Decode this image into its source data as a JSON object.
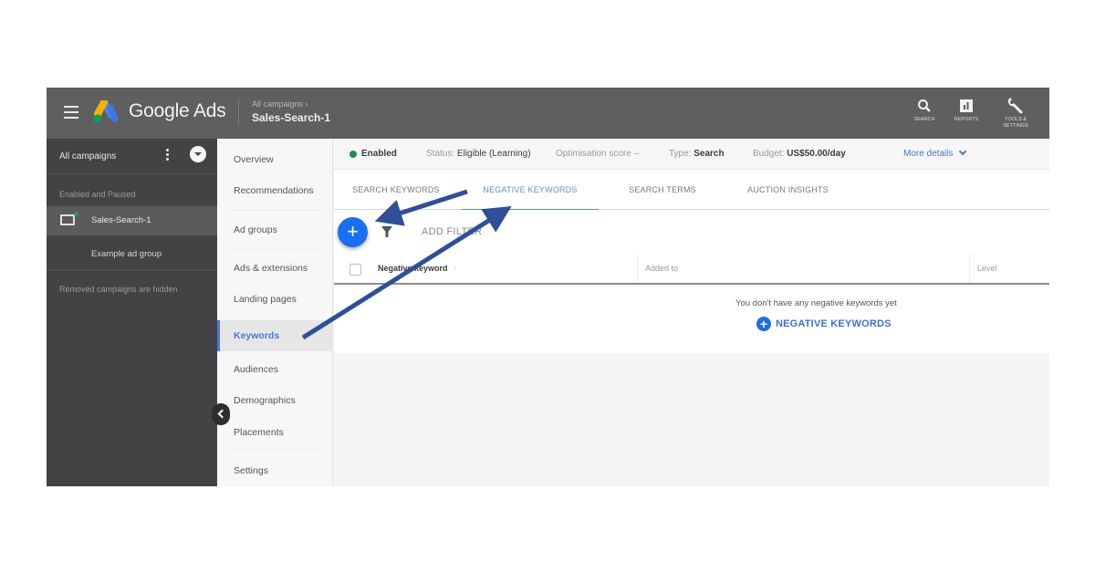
{
  "app": {
    "brand": "Google Ads",
    "breadcrumb_parent": "All campaigns",
    "breadcrumb_current": "Sales-Search-1"
  },
  "toolbar_right": [
    {
      "icon": "search-icon",
      "label": "SEARCH"
    },
    {
      "icon": "reports-icon",
      "label": "REPORTS"
    },
    {
      "icon": "wrench-icon",
      "label": "TOOLS & SETTINGS"
    }
  ],
  "left_panel": {
    "title": "All campaigns",
    "section_label": "Enabled and Paused",
    "campaign": "Sales-Search-1",
    "campaign_status_color": "#1e9e5a",
    "ad_group": "Example ad group",
    "removed_note": "Removed campaigns are hidden"
  },
  "nav": {
    "items": [
      {
        "label": "Overview",
        "active": false
      },
      {
        "label": "Recommendations",
        "active": false
      },
      {
        "label": "Ad groups",
        "active": false
      },
      {
        "label": "Ads & extensions",
        "active": false
      },
      {
        "label": "Landing pages",
        "active": false
      },
      {
        "label": "Keywords",
        "active": true
      },
      {
        "label": "Audiences",
        "active": false
      },
      {
        "label": "Demographics",
        "active": false
      },
      {
        "label": "Placements",
        "active": false
      },
      {
        "label": "Settings",
        "active": false
      }
    ]
  },
  "status_bar": {
    "enabled": "Enabled",
    "status_label": "Status:",
    "status_value": "Eligible (Learning)",
    "opt_label": "Optimisation score",
    "opt_value": "–",
    "type_label": "Type:",
    "type_value": "Search",
    "budget_label": "Budget:",
    "budget_value": "US$50.00/day",
    "more_details": "More details"
  },
  "tabs": [
    {
      "label": "SEARCH KEYWORDS",
      "active": false
    },
    {
      "label": "NEGATIVE KEYWORDS",
      "active": true
    },
    {
      "label": "SEARCH TERMS",
      "active": false
    },
    {
      "label": "AUCTION INSIGHTS",
      "active": false
    }
  ],
  "table_toolbar": {
    "add_button": "+",
    "add_filter": "ADD FILTER"
  },
  "table": {
    "columns": [
      "Negative keyword",
      "Added to",
      "Level"
    ],
    "rows": [],
    "empty_message": "You don't have any negative keywords yet",
    "empty_action": "NEGATIVE KEYWORDS"
  },
  "colors": {
    "accent": "#1a6ef0",
    "topbar": "#5f5f5f",
    "left_panel": "#444244",
    "annotation_arrow": "#2f4f9a"
  }
}
